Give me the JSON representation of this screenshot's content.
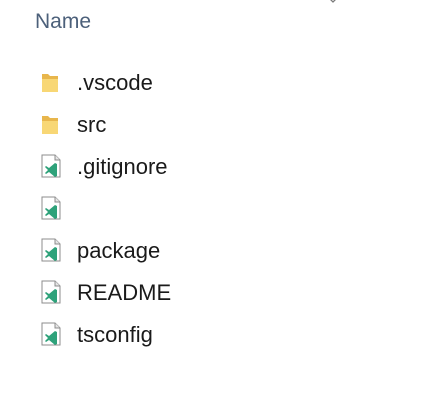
{
  "header": {
    "name_column": "Name"
  },
  "items": [
    {
      "name": ".vscode",
      "type": "folder"
    },
    {
      "name": "src",
      "type": "folder"
    },
    {
      "name": ".gitignore",
      "type": "file"
    },
    {
      "name": "",
      "type": "file"
    },
    {
      "name": "package",
      "type": "file"
    },
    {
      "name": "README",
      "type": "file"
    },
    {
      "name": "tsconfig",
      "type": "file"
    }
  ]
}
